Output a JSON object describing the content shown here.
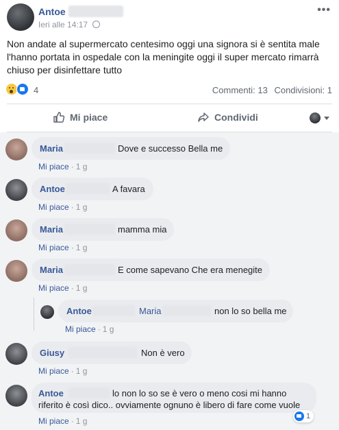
{
  "post": {
    "author": "Antoe",
    "time": "Ieri alle 14:17",
    "more_label": "•••",
    "text": "Non andate al supermercato centesimo oggi una signora si è sentita male l'hanno portata in ospedale con la meningite oggi il super mercato rimarrà chiuso per disinfettare tutto",
    "reaction_count": "4",
    "comments_stat": "Commenti: 13",
    "shares_stat": "Condivisioni: 1"
  },
  "actions": {
    "like": "Mi piace",
    "share": "Condividi"
  },
  "comments": [
    {
      "name": "Maria",
      "text": "Dove e successo Bella me",
      "like": "Mi piace",
      "sep": "·",
      "time": "1 g"
    },
    {
      "name": "Antoe",
      "text": "A favara",
      "like": "Mi piace",
      "sep": "·",
      "time": "1 g"
    },
    {
      "name": "Maria",
      "text": "mamma mia",
      "like": "Mi piace",
      "sep": "·",
      "time": "1 g"
    },
    {
      "name": "Maria",
      "text": "E come sapevano Che era menegite",
      "like": "Mi piace",
      "sep": "·",
      "time": "1 g"
    },
    {
      "name": "Antoe",
      "mention": "Maria",
      "text": "non lo so bella me",
      "like": "Mi piace",
      "sep": "·",
      "time": "1 g"
    },
    {
      "name": "Giusy",
      "text": "Non è vero",
      "like": "Mi piace",
      "sep": "·",
      "time": "1 g"
    },
    {
      "name": "Antoe",
      "text_line1": "lo non lo so se è vero o meno cosi mi hanno",
      "text_line2": "riferito è così dico.. ovviamente ognuno è libero di fare come vuole",
      "like": "Mi piace",
      "sep": "·",
      "time": "1 g",
      "reaction_count": "1"
    }
  ]
}
